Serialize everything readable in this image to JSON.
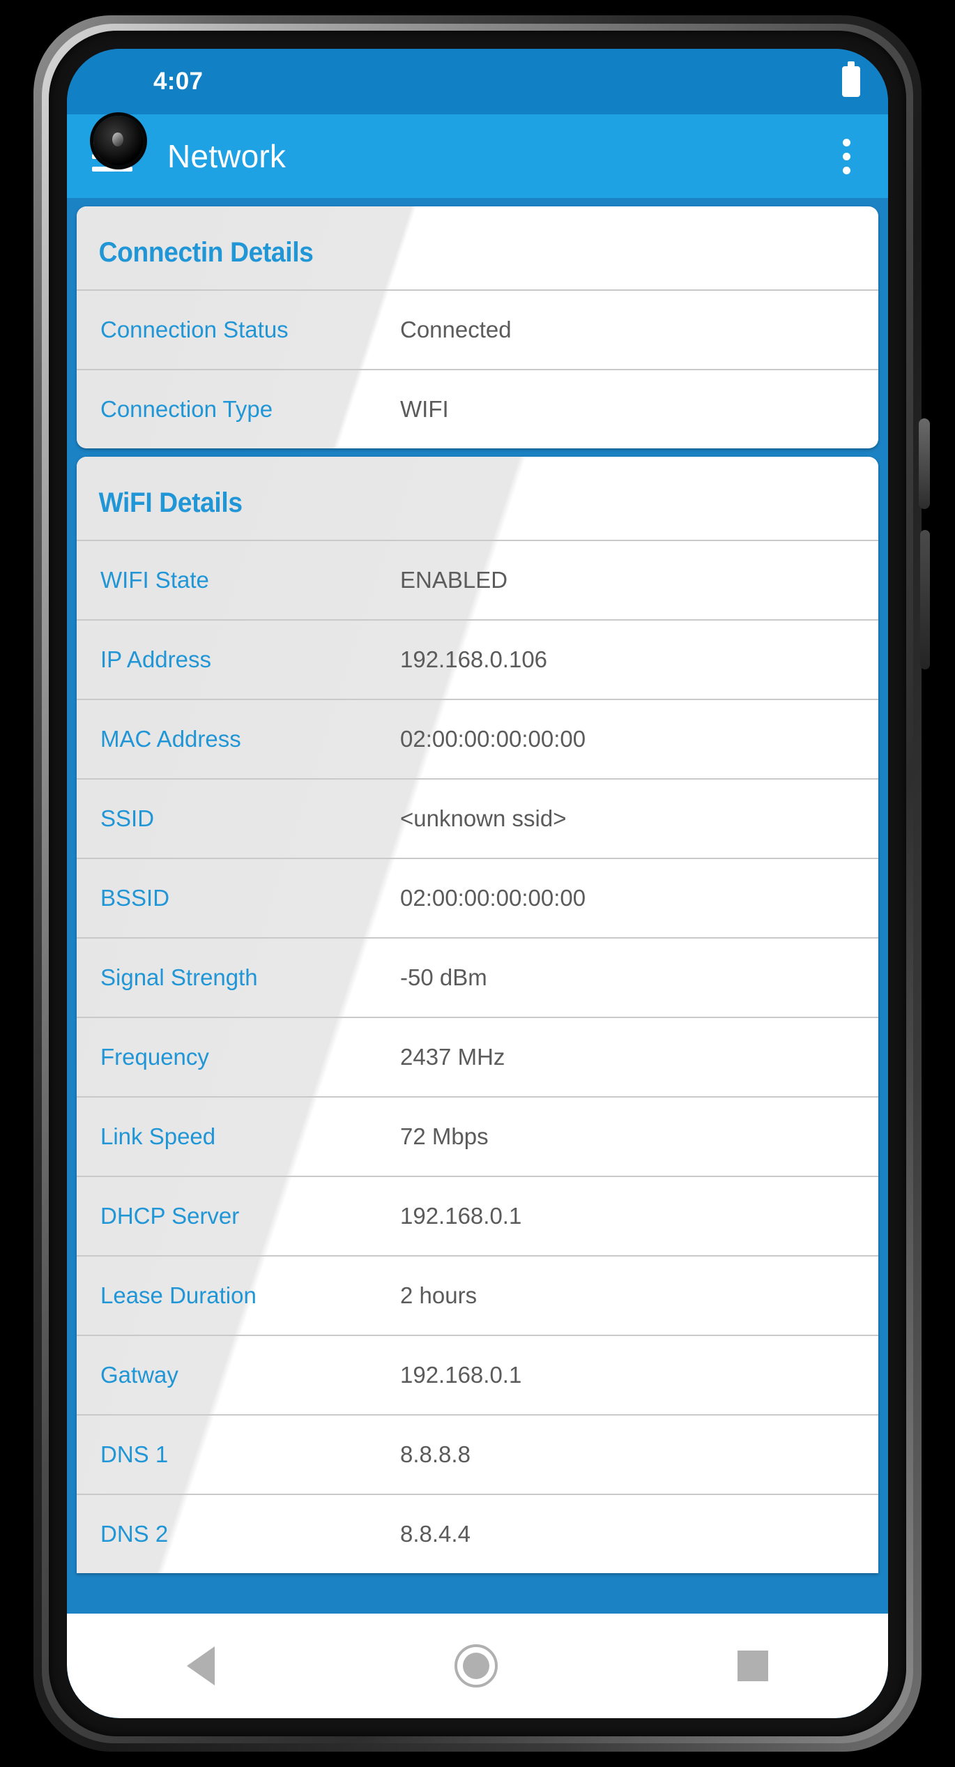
{
  "status_bar": {
    "time": "4:07",
    "battery_icon": "battery-full-icon"
  },
  "app_bar": {
    "menu_icon": "hamburger-menu-icon",
    "title": "Network",
    "overflow_icon": "more-vert-icon"
  },
  "cards": [
    {
      "title": "Connectin Details",
      "rows": [
        {
          "label": "Connection Status",
          "value": "Connected"
        },
        {
          "label": "Connection Type",
          "value": "WIFI"
        }
      ]
    },
    {
      "title": "WiFI Details",
      "rows": [
        {
          "label": "WIFI State",
          "value": "ENABLED"
        },
        {
          "label": "IP Address",
          "value": "192.168.0.106"
        },
        {
          "label": "MAC Address",
          "value": "02:00:00:00:00:00"
        },
        {
          "label": "SSID",
          "value": "<unknown ssid>"
        },
        {
          "label": "BSSID",
          "value": "02:00:00:00:00:00"
        },
        {
          "label": "Signal Strength",
          "value": "-50 dBm"
        },
        {
          "label": "Frequency",
          "value": "2437 MHz"
        },
        {
          "label": "Link Speed",
          "value": "72 Mbps"
        },
        {
          "label": "DHCP Server",
          "value": "192.168.0.1"
        },
        {
          "label": "Lease Duration",
          "value": "2 hours"
        },
        {
          "label": "Gatway",
          "value": "192.168.0.1"
        },
        {
          "label": "DNS 1",
          "value": "8.8.8.8"
        },
        {
          "label": "DNS 2",
          "value": "8.8.4.4"
        }
      ]
    }
  ],
  "nav_bar": {
    "back_icon": "back-triangle-icon",
    "home_icon": "home-circle-icon",
    "recents_icon": "recents-square-icon"
  },
  "colors": {
    "status_bar_blue": "#1180c4",
    "app_bar_blue": "#1fa2e4",
    "background_blue": "#1b82c4",
    "label_blue": "#2196d6",
    "value_gray": "#5b5b5b"
  }
}
